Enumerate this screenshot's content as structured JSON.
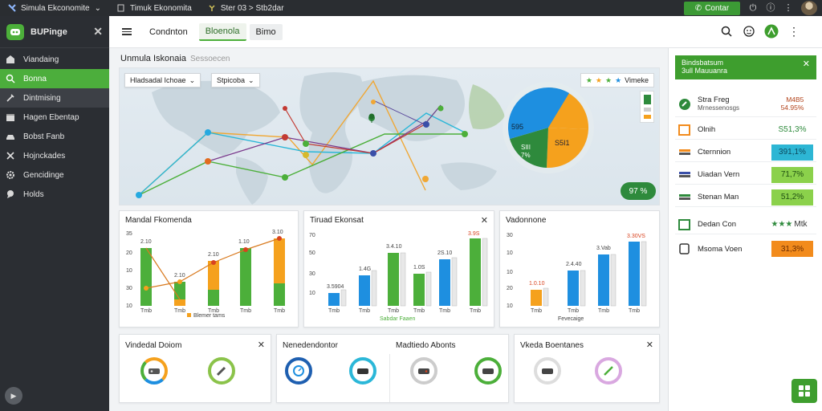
{
  "topbar": {
    "tabs": [
      "Simula Ekconomite",
      "Timuk Ekonomita",
      "Ster 03 > Stb2dar"
    ],
    "contact_label": "Contar"
  },
  "sidebar": {
    "brand": "BUPinge",
    "items": [
      {
        "label": "Viandaing",
        "icon": "storefront-icon"
      },
      {
        "label": "Bonna",
        "icon": "search-icon",
        "active": true
      },
      {
        "label": "Dintmising",
        "icon": "tools-icon",
        "hover": true
      },
      {
        "label": "Hagen Ebentap",
        "icon": "calendar-icon"
      },
      {
        "label": "Bobst Fanb",
        "icon": "car-icon"
      },
      {
        "label": "Hojnckades",
        "icon": "close-cross-icon"
      },
      {
        "label": "Gencidinge",
        "icon": "gear-icon"
      },
      {
        "label": "Holds",
        "icon": "pin-icon"
      }
    ]
  },
  "header": {
    "tabs": [
      "Condnton",
      "Bloenola",
      "Bimo"
    ]
  },
  "main": {
    "title": "Unmula Iskonaia",
    "subtitle": "Sessoecen",
    "select1": "Hladsadal Ichoae",
    "select2": "Stpicoba",
    "rating_label": "Vimeke",
    "pie_labels": [
      "595",
      "S5I1",
      "SIII\n7%"
    ],
    "pill": "97 %"
  },
  "cards": [
    {
      "title": "Mandal Fkomenda",
      "legend": "Blemer tams",
      "close": false,
      "y_ticks": [
        "35",
        "20",
        "10",
        "30",
        "10"
      ],
      "x_labels": [
        "Tmb",
        "Tmb",
        "Tmb",
        "Tmb",
        "Tmb"
      ],
      "labels": [
        "2.10",
        "2.10",
        "2.10",
        "1.10",
        "3.10"
      ]
    },
    {
      "title": "Tiruad Ekonsat",
      "legend": "Sabdar Faaen",
      "close": true,
      "y_ticks": [
        "70",
        "50",
        "30",
        "10"
      ],
      "x_labels": [
        "Tmb",
        "Tmb",
        "Tmb",
        "Tmb",
        "Tmb",
        "Tmb"
      ],
      "labels": [
        "3.5904",
        "1.4G",
        "3.4.10",
        "1.0S",
        "2S.10",
        "3.9S"
      ]
    },
    {
      "title": "Vadonnone",
      "legend": "Fevecaige",
      "close": false,
      "y_ticks": [
        "30",
        "10",
        "10",
        "20",
        "10"
      ],
      "x_labels": [
        "Tmb",
        "Tmb",
        "Tmb",
        "Tmb"
      ],
      "labels": [
        "1.0.10",
        "2.4.40",
        "3.Vab",
        "3.30VS"
      ]
    }
  ],
  "bottom_cards": [
    {
      "title": "Vindedal Doiom",
      "close": true
    },
    {
      "title": "Nenedendontor",
      "close": false
    },
    {
      "title": "Madtiedo Abonts",
      "close": false
    },
    {
      "title": "Vkeda Boentanes",
      "close": true
    }
  ],
  "right_panel": {
    "head_title": "Bindsbatsum",
    "head_sub": "3ull Mauuanra",
    "rows": [
      {
        "label": "Stra Freg",
        "sub": "Mrnessenosgs",
        "value": "M4B5\n54.95%",
        "color": ""
      },
      {
        "label": "Olnih",
        "value": "S51,3%",
        "color": ""
      },
      {
        "label": "Cternnion",
        "value": "391,1%",
        "color": "#2db6d4"
      },
      {
        "label": "Uiadan Vern",
        "value": "71,7%",
        "color": "#8bd14b"
      },
      {
        "label": "Stenan Man",
        "value": "51,2%",
        "color": "#8bd14b"
      },
      {
        "label": "Dedan Con",
        "value": "Mtk",
        "color": ""
      },
      {
        "label": "Msoma Voen",
        "value": "31,3%",
        "color": "#f28b1c"
      }
    ]
  },
  "colors": {
    "green": "#4caf3a",
    "blue": "#1e8fe0",
    "orange": "#f5a11d",
    "dark": "#2b2e33"
  }
}
